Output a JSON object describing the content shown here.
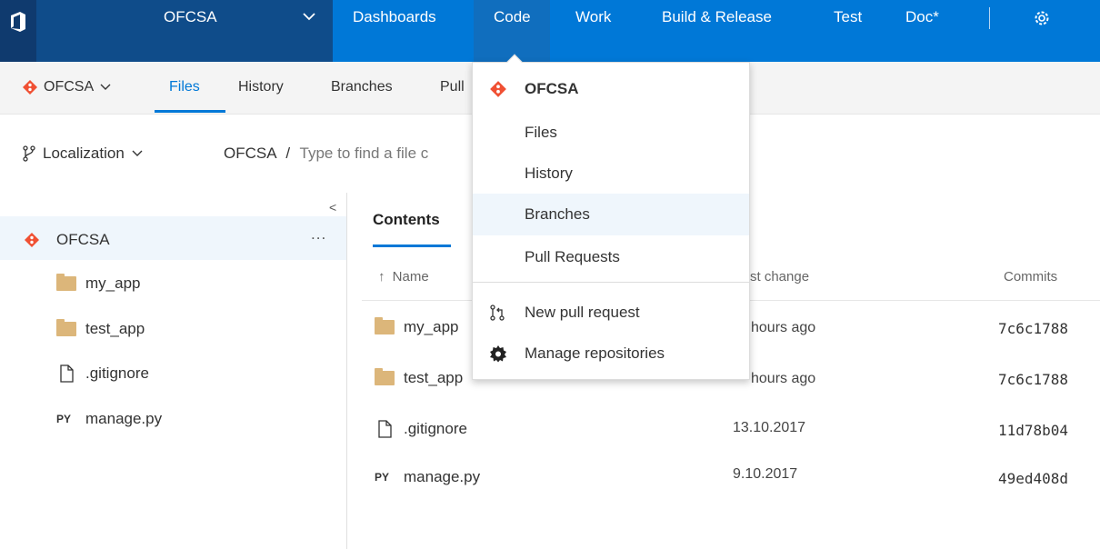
{
  "topbar": {
    "project": "OFCSA",
    "nav": [
      {
        "label": "Dashboards"
      },
      {
        "label": "Code"
      },
      {
        "label": "Work"
      },
      {
        "label": "Build & Release"
      },
      {
        "label": "Test"
      },
      {
        "label": "Doc*"
      }
    ],
    "settings_icon": "gear-icon"
  },
  "subnav": {
    "repo": "OFCSA",
    "tabs": [
      "Files",
      "History",
      "Branches",
      "Pull"
    ]
  },
  "breadcrumb": {
    "branch": "Localization",
    "repo": "OFCSA",
    "separator": "/",
    "placeholder": "Type to find a file c"
  },
  "tree": {
    "collapse": "<",
    "root": "OFCSA",
    "more": "...",
    "items": [
      {
        "label": "my_app",
        "icon": "folder-icon"
      },
      {
        "label": "test_app",
        "icon": "folder-icon"
      },
      {
        "label": ".gitignore",
        "icon": "file-icon"
      },
      {
        "label": "manage.py",
        "icon": "python-file-icon",
        "badge": "PY"
      }
    ]
  },
  "contents": {
    "tab": "Contents",
    "columns": {
      "sort_arrow": "↑",
      "name": "Name",
      "last_change": "st change",
      "commits": "Commits"
    },
    "rows": [
      {
        "name": "my_app",
        "icon": "folder-icon",
        "changed": "hours ago",
        "commit": "7c6c1788"
      },
      {
        "name": "test_app",
        "icon": "folder-icon",
        "changed": "hours ago",
        "commit": "7c6c1788"
      },
      {
        "name": ".gitignore",
        "icon": "file-icon",
        "changed": "13.10.2017",
        "commit": "11d78b04"
      },
      {
        "name": "manage.py",
        "icon": "python-file-icon",
        "badge": "PY",
        "changed": "9.10.2017",
        "commit": "49ed408d"
      }
    ]
  },
  "code_menu": {
    "header": "OFCSA",
    "items": [
      "Files",
      "History",
      "Branches",
      "Pull Requests"
    ],
    "actions": [
      "New pull request",
      "Manage repositories"
    ],
    "highlighted": "Branches"
  },
  "colors": {
    "accent": "#0078d7",
    "topbar_dark": "#0f4c8a",
    "git_orange": "#f05033",
    "folder": "#dcb67a"
  }
}
